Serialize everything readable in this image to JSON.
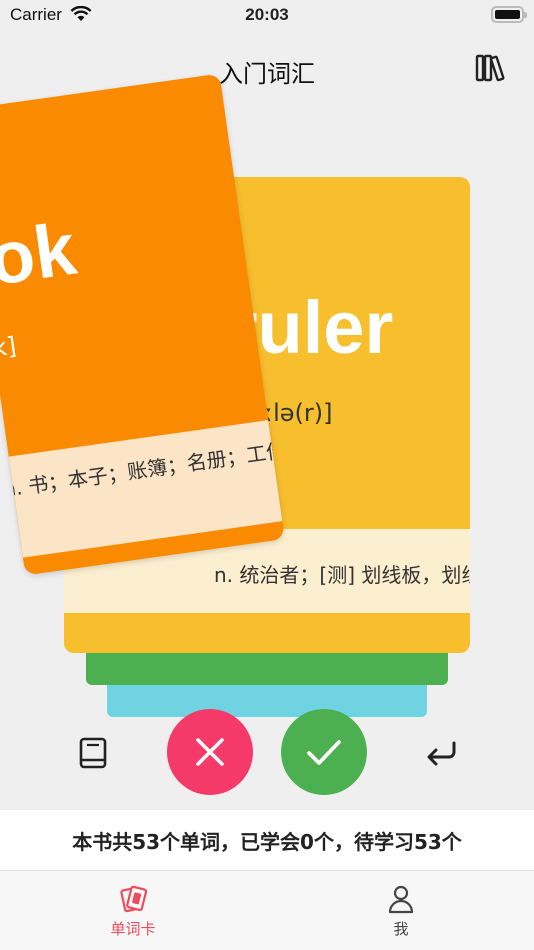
{
  "status_bar": {
    "carrier": "Carrier",
    "time": "20:03"
  },
  "nav": {
    "title": "入门词汇",
    "books_icon": "books-icon"
  },
  "cards": {
    "front": {
      "word": "book",
      "phonetic": "[bʊk]",
      "definition": "n. 书；本子；账簿；名册；工作簿",
      "color": "#fa8a00"
    },
    "back": {
      "word": "ruler",
      "phonetic": "[ˈruːlə(r)]",
      "definition": "n. 统治者；[测] 划线板，划线的人",
      "color": "#f7be2e"
    },
    "stack_colors": [
      "#4cb050",
      "#6fd3e1"
    ]
  },
  "controls": {
    "book_icon": "book-icon",
    "wrong_icon": "x-icon",
    "right_icon": "check-icon",
    "undo_icon": "undo-arrow-icon",
    "wrong_color": "#f53a69",
    "right_color": "#4cb050"
  },
  "summary": {
    "text": "本书共53个单词，已学会0个，待学习53个"
  },
  "tabbar": {
    "tabs": [
      {
        "label": "单词卡",
        "icon": "cards-icon",
        "active": true,
        "color": "#ef4b5c"
      },
      {
        "label": "我",
        "icon": "person-icon",
        "active": false
      }
    ]
  }
}
